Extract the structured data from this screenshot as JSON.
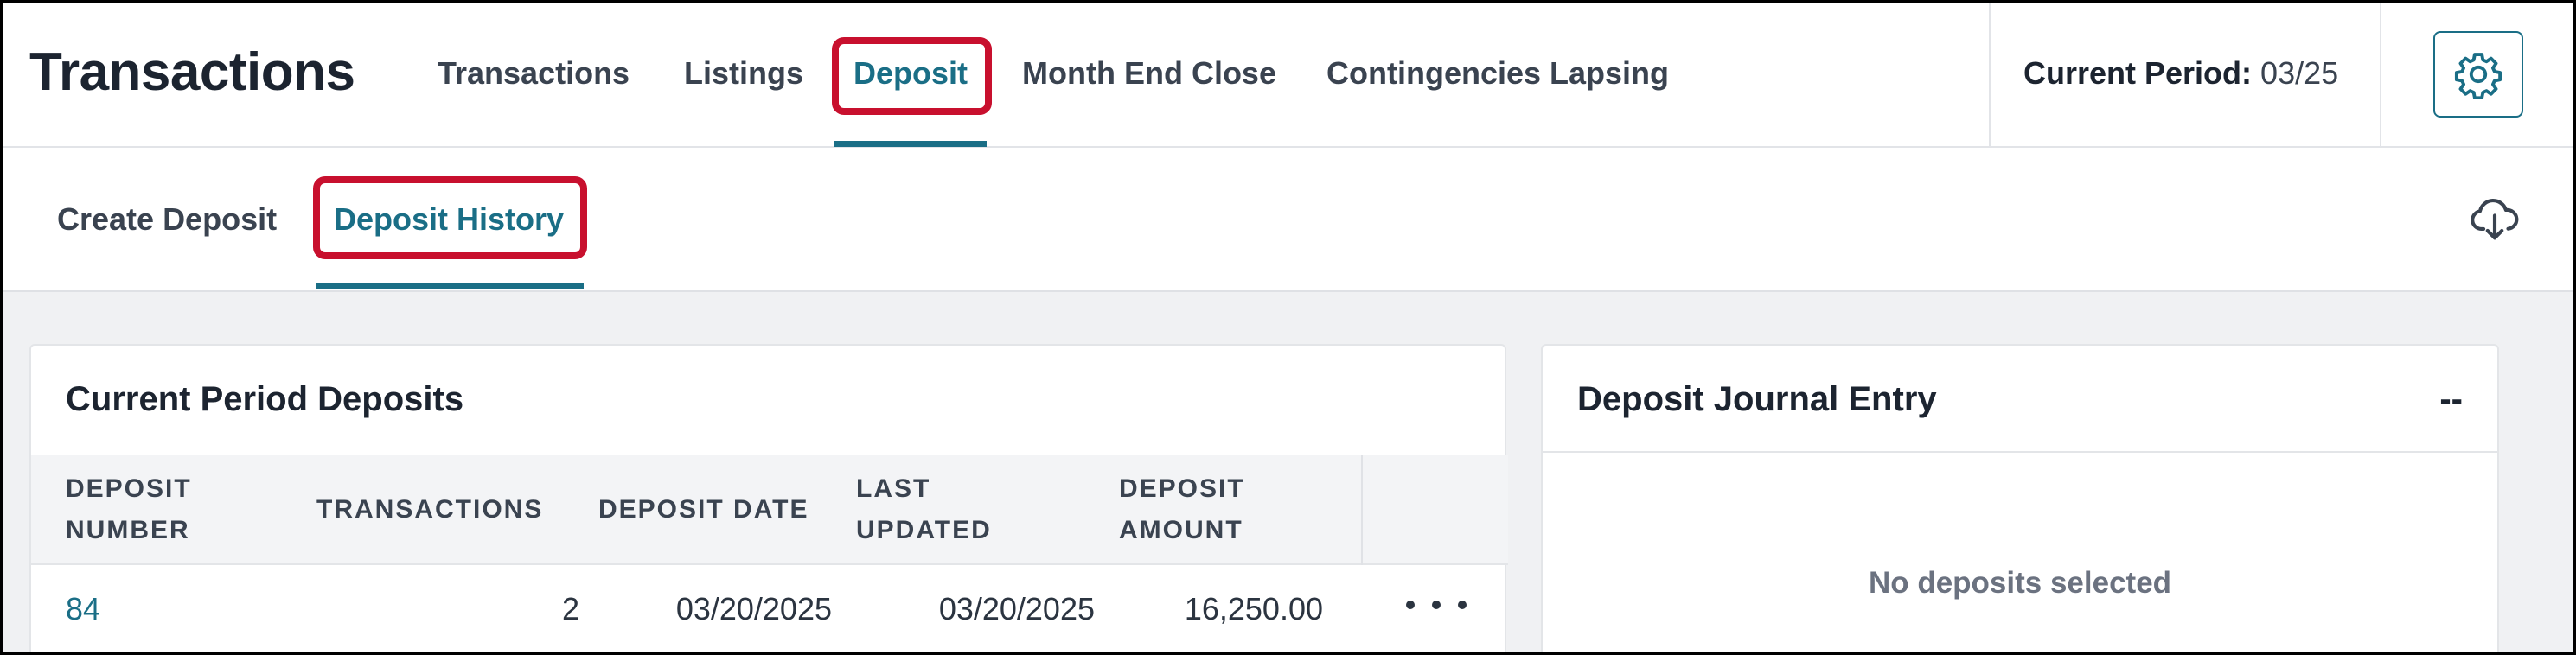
{
  "app": {
    "title": "Transactions"
  },
  "nav": {
    "tabs": [
      {
        "label": "Transactions"
      },
      {
        "label": "Listings"
      },
      {
        "label": "Deposit"
      },
      {
        "label": "Month End Close"
      },
      {
        "label": "Contingencies Lapsing"
      }
    ],
    "active_tab": "Deposit"
  },
  "period": {
    "label": "Current Period:",
    "value": "03/25"
  },
  "settings": {
    "icon": "gear-icon"
  },
  "subnav": {
    "tabs": [
      {
        "label": "Create Deposit"
      },
      {
        "label": "Deposit History"
      }
    ],
    "active_tab": "Deposit History",
    "download_icon": "cloud-download-icon"
  },
  "deposits_card": {
    "title": "Current Period Deposits",
    "columns": {
      "deposit_number_1": "DEPOSIT",
      "deposit_number_2": "NUMBER",
      "transactions": "TRANSACTIONS",
      "deposit_date": "DEPOSIT DATE",
      "last_updated_1": "LAST",
      "last_updated_2": "UPDATED",
      "deposit_amount_1": "DEPOSIT",
      "deposit_amount_2": "AMOUNT"
    },
    "rows": [
      {
        "deposit_number": "84",
        "transactions": "2",
        "deposit_date": "03/20/2025",
        "last_updated": "03/20/2025",
        "deposit_amount": "16,250.00"
      }
    ]
  },
  "journal_card": {
    "title": "Deposit Journal Entry",
    "value": "--",
    "empty_message": "No deposits selected"
  },
  "colors": {
    "accent": "#1a6e86",
    "highlight": "#c8102e",
    "background": "#f0f1f3"
  }
}
